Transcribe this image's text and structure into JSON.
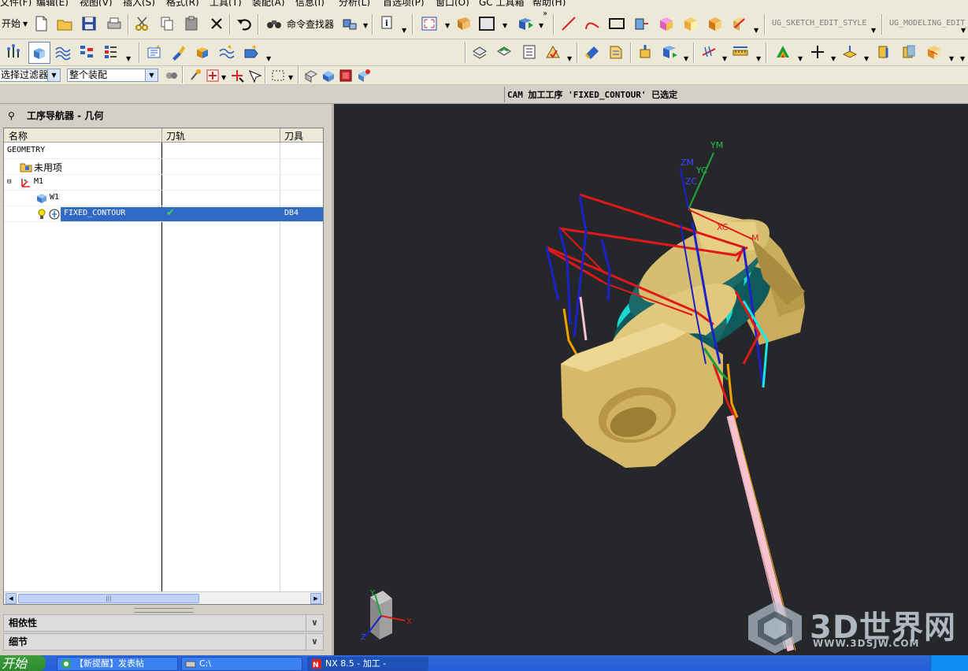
{
  "menu": [
    "文件(F)",
    "编辑(E)",
    "视图(V)",
    "插入(S)",
    "格式(R)",
    "工具(T)",
    "装配(A)",
    "信息(I)",
    "分析(L)",
    "首选项(P)",
    "窗口(O)",
    "GC 工具箱",
    "帮助(H)"
  ],
  "toolbar": {
    "start_label": "开始",
    "command_finder_label": "命令查找器",
    "sketch_style": "UG_SKETCH_EDIT_STYLE",
    "modeling_style": "UG_MODELING_EDIT_"
  },
  "selection": {
    "filter_label": "选择过滤器",
    "scope_value": "整个装配"
  },
  "status": {
    "message": "CAM 加工工序 'FIXED_CONTOUR' 已选定"
  },
  "navigator": {
    "title": "工序导航器 - 几何",
    "columns": [
      "名称",
      "刀轨",
      "刀具"
    ],
    "rows": [
      {
        "name": "GEOMETRY",
        "toolpath": "",
        "tool": ""
      },
      {
        "name": "未用项",
        "toolpath": "",
        "tool": ""
      },
      {
        "name": "M1",
        "toolpath": "",
        "tool": ""
      },
      {
        "name": "W1",
        "toolpath": "",
        "tool": ""
      },
      {
        "name": "FIXED_CONTOUR",
        "toolpath": "✔",
        "tool": "DB4"
      }
    ],
    "sections": [
      "相依性",
      "细节"
    ]
  },
  "viewport": {
    "wcs_labels": [
      "YM",
      "YC",
      "ZM",
      "ZC",
      "XC",
      "M"
    ],
    "triad_labels": [
      "Y",
      "X",
      "Z"
    ],
    "watermark": "3D世界网",
    "watermark_url": "WWW.3DSJW.COM"
  },
  "taskbar": {
    "start": "开始",
    "tasks": [
      "【新提醒】发表帖",
      "C:\\",
      "NX 8.5 - 加工 -"
    ]
  },
  "colors": {
    "viewport_bg": "#26272b",
    "part_gold": "#d9c27a",
    "part_teal": "#2a6f6f",
    "path_red": "#e01818",
    "path_blue": "#1a22c8",
    "path_cyan": "#19e6e6",
    "selection": "#316ac5"
  }
}
